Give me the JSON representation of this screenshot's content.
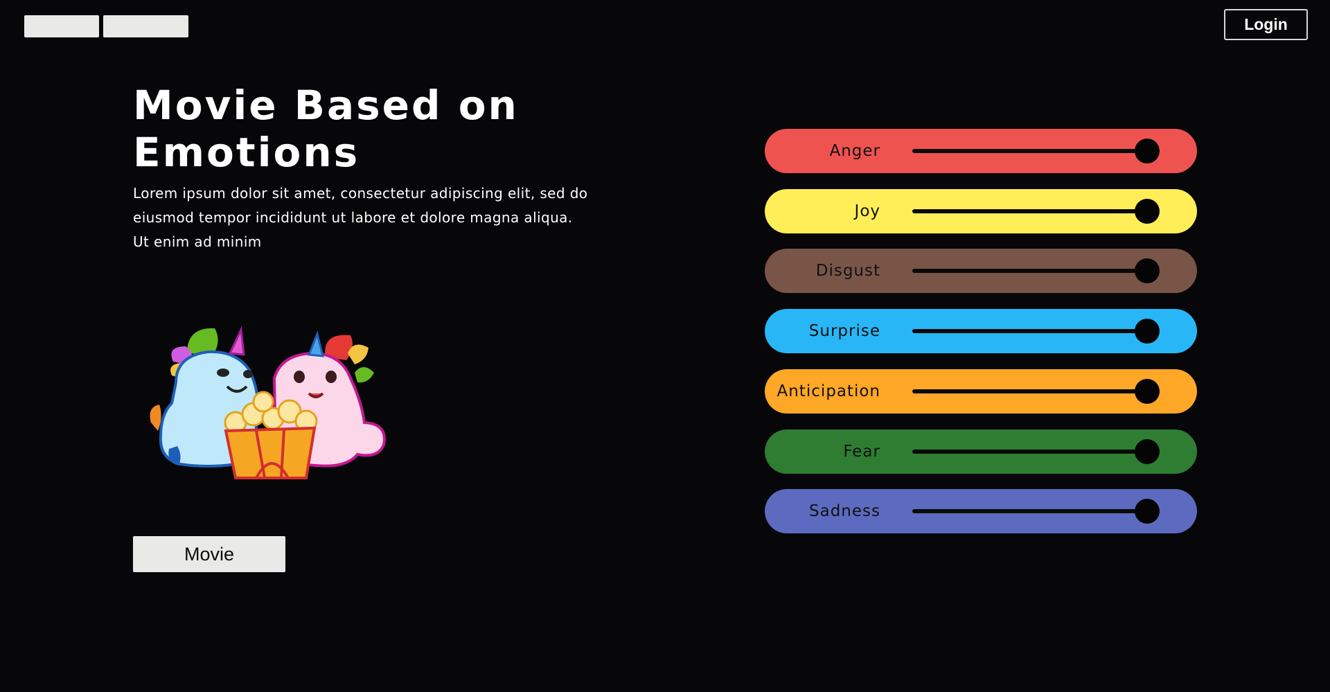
{
  "header": {
    "login_label": "Login"
  },
  "main": {
    "title": "Movie Based on Emotions",
    "description": "Lorem ipsum dolor sit amet, consectetur adipiscing elit, sed do eiusmod tempor incididunt ut labore et dolore magna aliqua. Ut enim ad minim",
    "movie_button_label": "Movie"
  },
  "emotions": [
    {
      "label": "Anger",
      "color": "#ef5350",
      "level": 1.0
    },
    {
      "label": "Joy",
      "color": "#ffee58",
      "level": 1.0
    },
    {
      "label": "Disgust",
      "color": "#795548",
      "level": 1.0
    },
    {
      "label": "Surprise",
      "color": "#29b6f6",
      "level": 1.0
    },
    {
      "label": "Anticipation",
      "color": "#ffa726",
      "level": 1.0
    },
    {
      "label": "Fear",
      "color": "#2e7d32",
      "level": 1.0
    },
    {
      "label": "Sadness",
      "color": "#5c6bc0",
      "level": 1.0
    }
  ]
}
